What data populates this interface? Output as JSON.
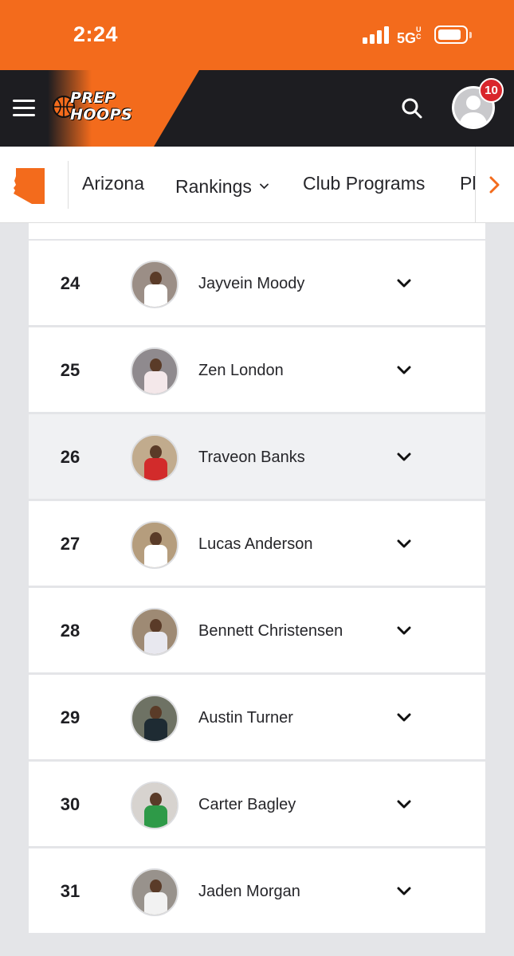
{
  "status_bar": {
    "time": "2:24",
    "network": "5G",
    "network_sup": "UC"
  },
  "header": {
    "logo_line1": "PREP",
    "logo_line2": "HOOPS",
    "notifications": "10"
  },
  "nav": {
    "state_icon": "arizona-state-icon",
    "items": [
      {
        "label": "Arizona"
      },
      {
        "label": "Rankings",
        "has_dropdown": true
      },
      {
        "label": "Club Programs"
      },
      {
        "label": "Pl"
      }
    ]
  },
  "rankings": [
    {
      "rank": "24",
      "name": "Jayvein Moody",
      "jersey": "#ffffff",
      "bg": "#9b8e86"
    },
    {
      "rank": "25",
      "name": "Zen London",
      "jersey": "#f4e8ea",
      "bg": "#8f8a8e"
    },
    {
      "rank": "26",
      "name": "Traveon Banks",
      "jersey": "#d22b2b",
      "bg": "#c1ab8d"
    },
    {
      "rank": "27",
      "name": "Lucas Anderson",
      "jersey": "#ffffff",
      "bg": "#b59d7d"
    },
    {
      "rank": "28",
      "name": "Bennett Christensen",
      "jersey": "#e8e8ef",
      "bg": "#9e8a74"
    },
    {
      "rank": "29",
      "name": "Austin Turner",
      "jersey": "#1e2b33",
      "bg": "#6e7264"
    },
    {
      "rank": "30",
      "name": "Carter Bagley",
      "jersey": "#2e9a48",
      "bg": "#d7d3cf"
    },
    {
      "rank": "31",
      "name": "Jaden Morgan",
      "jersey": "#f2f2f2",
      "bg": "#98928c"
    }
  ],
  "colors": {
    "brand_orange": "#f36b1c",
    "header_dark": "#1d1d21",
    "badge_red": "#d9262c"
  }
}
